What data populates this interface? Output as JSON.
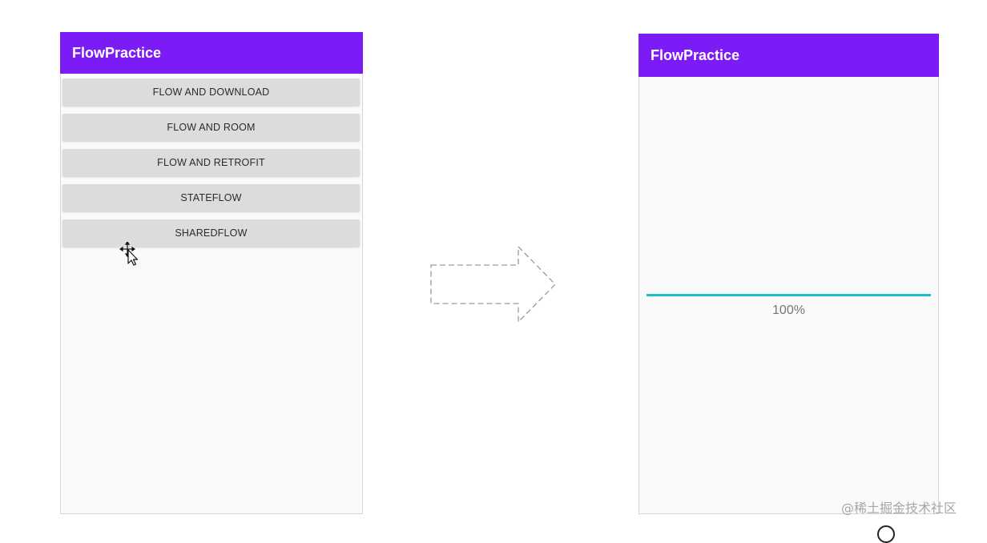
{
  "left_screen": {
    "app_title": "FlowPractice",
    "buttons": [
      {
        "label": "FLOW AND DOWNLOAD"
      },
      {
        "label": "FLOW AND ROOM"
      },
      {
        "label": "FLOW AND RETROFIT"
      },
      {
        "label": "STATEFLOW"
      },
      {
        "label": "SHAREDFLOW"
      }
    ],
    "cursor_icon": "move-cursor-icon"
  },
  "transition_arrow_icon": "dashed-right-arrow-icon",
  "right_screen": {
    "app_title": "FlowPractice",
    "progress": {
      "value": 1.0,
      "label": "100%",
      "color": "#16c0c8"
    }
  },
  "watermark": "@稀土掘金技术社区",
  "colors": {
    "app_bar": "#7b1cf6",
    "button_background": "#dcdcdc",
    "screen_background": "#fafafa"
  }
}
